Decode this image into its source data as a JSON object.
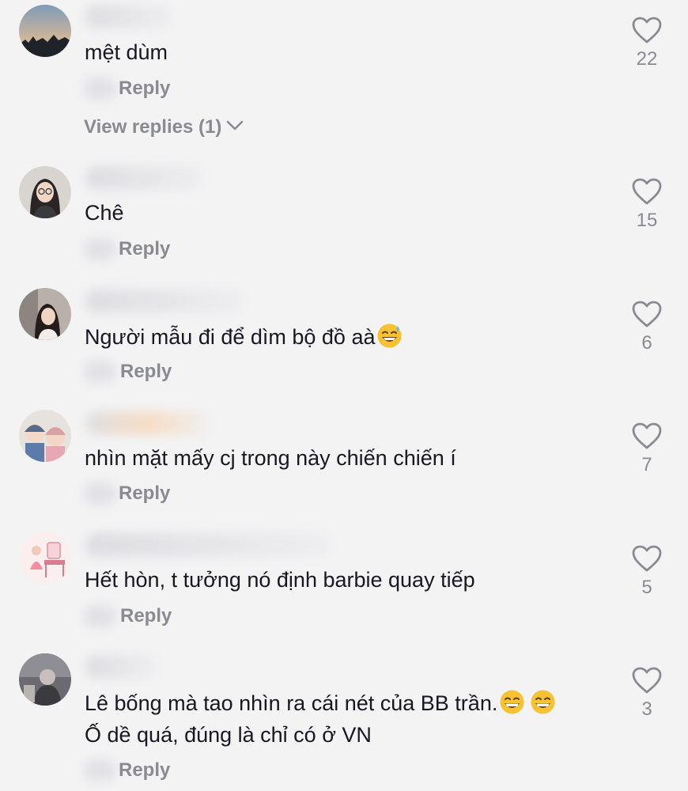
{
  "reply_label": "Reply",
  "comments": [
    {
      "text": "mệt dùm",
      "likes": "22",
      "view_replies": "View replies (1)"
    },
    {
      "text": "Chê",
      "likes": "15"
    },
    {
      "text": "Người mẫu đi để dìm bộ đồ aà",
      "emoji": "sweat-smile-emoji",
      "likes": "6"
    },
    {
      "text": "nhìn mặt mấy cj trong này chiến chiến í",
      "likes": "7"
    },
    {
      "text": "Hết hòn, t tưởng nó định barbie quay tiếp",
      "likes": "5"
    },
    {
      "text": "Lê bống mà tao nhìn ra cái nét của BB trần.",
      "emoji": "grinning-emoji",
      "text2": "Ố dề quá, đúng là chỉ có ở VN",
      "likes": "3"
    }
  ],
  "icons": {
    "like": "heart-outline-icon",
    "expand": "chevron-down-icon"
  },
  "colors": {
    "background": "#f3f3f4",
    "muted": "#8a8b91",
    "text": "#181820",
    "emoji": "#f6c232"
  }
}
